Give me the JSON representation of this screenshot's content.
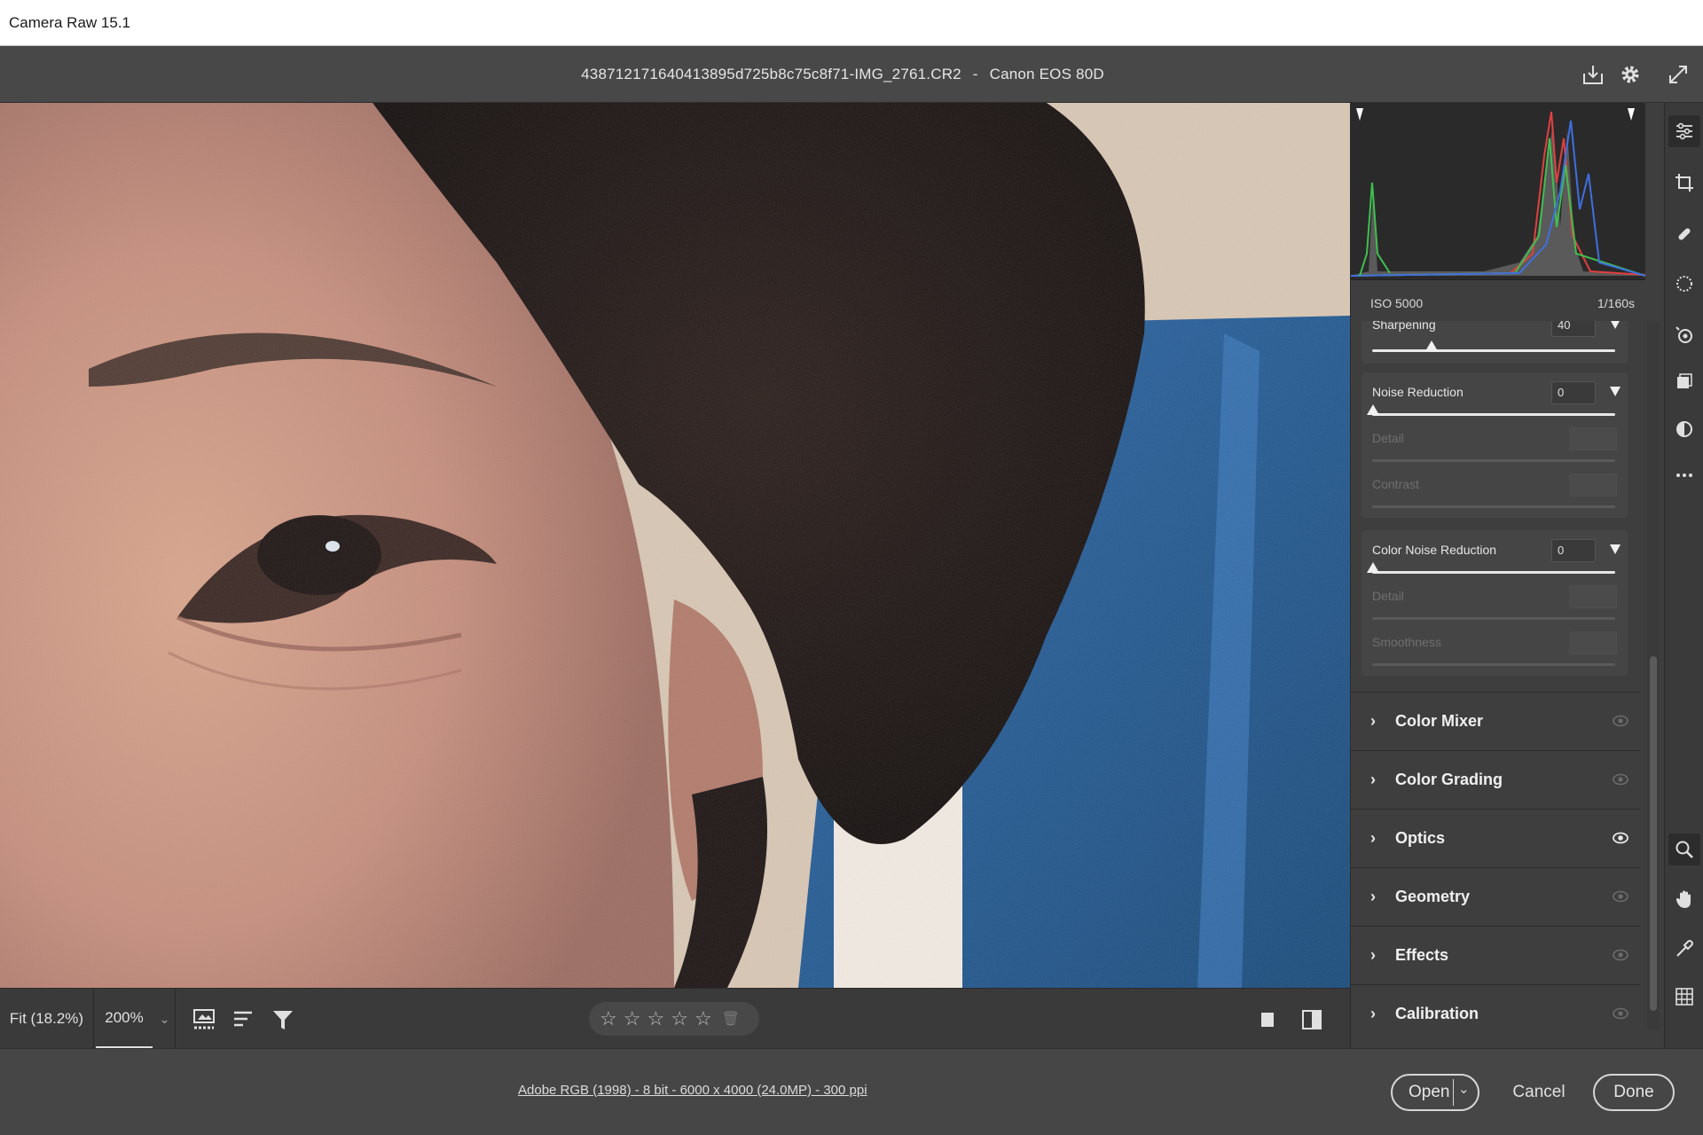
{
  "window": {
    "title": "Camera Raw 15.1"
  },
  "header": {
    "file_name": "438712171640413895d725b8c75c8f71-IMG_2761.CR2",
    "separator": "-",
    "camera": "Canon EOS 80D",
    "icons": [
      "save-icon",
      "settings-gear-icon",
      "fullscreen-icon"
    ]
  },
  "histogram": {
    "iso": "ISO 5000",
    "shutter": "1/160s",
    "colors": {
      "red": "#e04040",
      "green": "#3fbf4f",
      "blue": "#3f6fe0",
      "gray": "#9a9a9a"
    }
  },
  "detail_panel": {
    "sharpening": {
      "label": "Sharpening",
      "value": "40",
      "level": 0.22
    },
    "noise_reduction": {
      "label": "Noise Reduction",
      "value": "0",
      "level": 0.0,
      "detail_label": "Detail",
      "contrast_label": "Contrast"
    },
    "color_noise_reduction": {
      "label": "Color Noise Reduction",
      "value": "0",
      "level": 0.0,
      "detail_label": "Detail",
      "smoothness_label": "Smoothness"
    }
  },
  "sections": [
    {
      "name": "Color Mixer",
      "visible": false
    },
    {
      "name": "Color Grading",
      "visible": false
    },
    {
      "name": "Optics",
      "visible": true
    },
    {
      "name": "Geometry",
      "visible": false
    },
    {
      "name": "Effects",
      "visible": false
    },
    {
      "name": "Calibration",
      "visible": false
    }
  ],
  "view_bar": {
    "fit_label": "Fit (18.2%)",
    "zoom_label": "200%",
    "rating_stars": 5,
    "rating_value": 0
  },
  "footer": {
    "workflow_info": "Adobe RGB (1998) - 8 bit - 6000 x 4000 (24.0MP) - 300 ppi",
    "open_label": "Open",
    "cancel_label": "Cancel",
    "done_label": "Done"
  },
  "accent_colors": {
    "panel": "#3e3e3e",
    "header": "#484848",
    "active_tool": "#2c2c2c"
  }
}
